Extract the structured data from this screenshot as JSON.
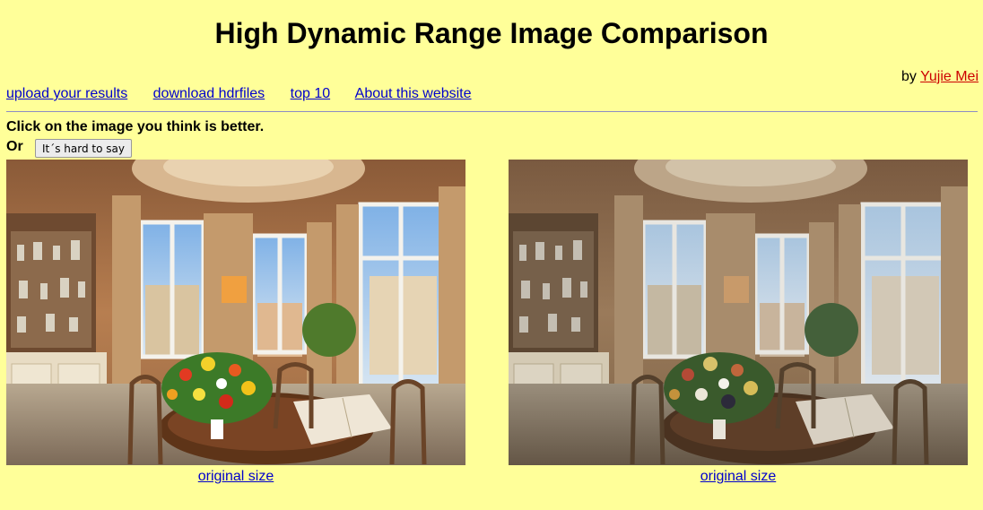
{
  "page": {
    "title": "High Dynamic Range Image Comparison",
    "by_prefix": "by",
    "author": "Yujie Mei"
  },
  "nav": {
    "upload": "upload your results",
    "download": "download hdrfiles",
    "top10": "top 10",
    "about": "About this website"
  },
  "instructions": "Click on the image you think is better.",
  "or_label": "Or",
  "hard_button": "It´s hard to say",
  "images": [
    {
      "link": "original size",
      "tone": "bright-saturated"
    },
    {
      "link": "original size",
      "tone": "muted-dim"
    }
  ],
  "colors": {
    "background": "#ffff99",
    "link": "#0000cc",
    "author_link": "#cc0000",
    "rule": "#8c8cc4"
  }
}
